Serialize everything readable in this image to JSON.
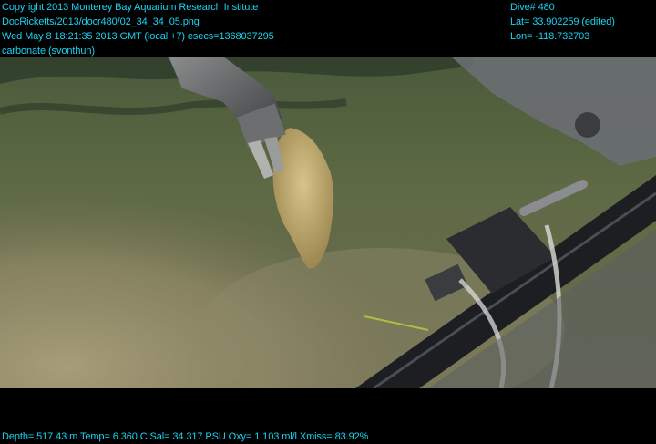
{
  "overlay": {
    "top_left": [
      "Copyright 2013 Monterey Bay Aquarium Research Institute",
      "DocRicketts/2013/docr480/02_34_34_05.png",
      "Wed May  8 18:21:35 2013 GMT (local +7)  esecs=1368037295",
      "carbonate (svonthun)"
    ],
    "top_right": [
      "Dive# 480",
      "Lat= 33.902259 (edited)",
      "Lon= -118.732703"
    ],
    "bottom": "Depth= 517.43 m  Temp= 6.360 C  Sal= 34.317 PSU  Oxy= 1.103 ml/l  Xmiss= 83.92%"
  },
  "colors": {
    "overlay_text": "#18d4f0",
    "seafloor": "#5e6844",
    "sediment_cloud": "#8f8a6a",
    "carbonate_rock": "#c8b27a"
  }
}
